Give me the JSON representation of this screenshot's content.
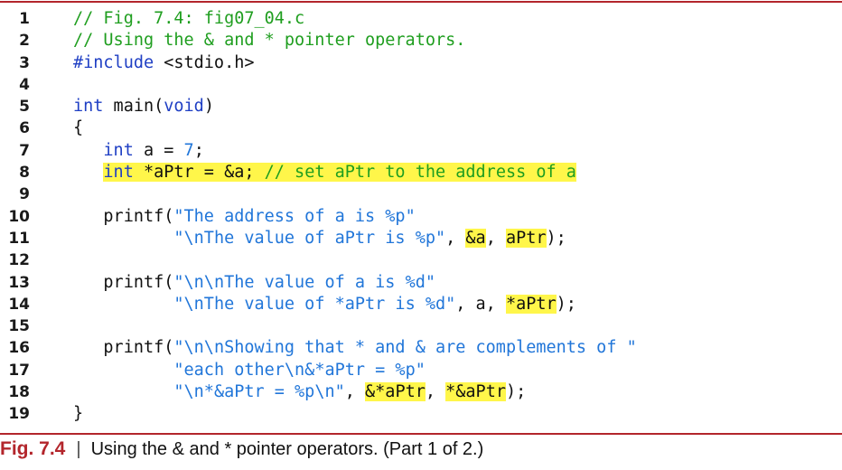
{
  "code_lines": [
    {
      "num": "1",
      "text": "// Fig. 7.4: fig07_04.c"
    },
    {
      "num": "2",
      "text": "// Using the & and * pointer operators."
    },
    {
      "num": "3",
      "text": "#include <stdio.h>"
    },
    {
      "num": "4",
      "text": ""
    },
    {
      "num": "5",
      "text": "int main(void)"
    },
    {
      "num": "6",
      "text": "{"
    },
    {
      "num": "7",
      "text": "   int a = 7;"
    },
    {
      "num": "8",
      "text": "   int *aPtr = &a; // set aPtr to the address of a"
    },
    {
      "num": "9",
      "text": ""
    },
    {
      "num": "10",
      "text": "   printf(\"The address of a is %p\""
    },
    {
      "num": "11",
      "text": "          \"\\nThe value of aPtr is %p\", &a, aPtr);"
    },
    {
      "num": "12",
      "text": ""
    },
    {
      "num": "13",
      "text": "   printf(\"\\n\\nThe value of a is %d\""
    },
    {
      "num": "14",
      "text": "          \"\\nThe value of *aPtr is %d\", a, *aPtr);"
    },
    {
      "num": "15",
      "text": ""
    },
    {
      "num": "16",
      "text": "   printf(\"\\n\\nShowing that * and & are complements of \""
    },
    {
      "num": "17",
      "text": "          \"each other\\n&*aPtr = %p\""
    },
    {
      "num": "18",
      "text": "          \"\\n*&aPtr = %p\\n\", &*aPtr, *&aPtr);"
    },
    {
      "num": "19",
      "text": "}"
    }
  ],
  "caption": {
    "figure": "Fig. 7.4",
    "separator": "|",
    "text_before": "Using the ",
    "op_amp": "&",
    "text_middle": " and ",
    "op_star": "*",
    "text_after": " pointer operators. (Part 1 of 2.)"
  },
  "colors": {
    "rule": "#b3262c",
    "comment": "#1f9e1f",
    "string": "#2176d9",
    "keyword": "#1f3fc4",
    "highlight": "#fff64a"
  }
}
